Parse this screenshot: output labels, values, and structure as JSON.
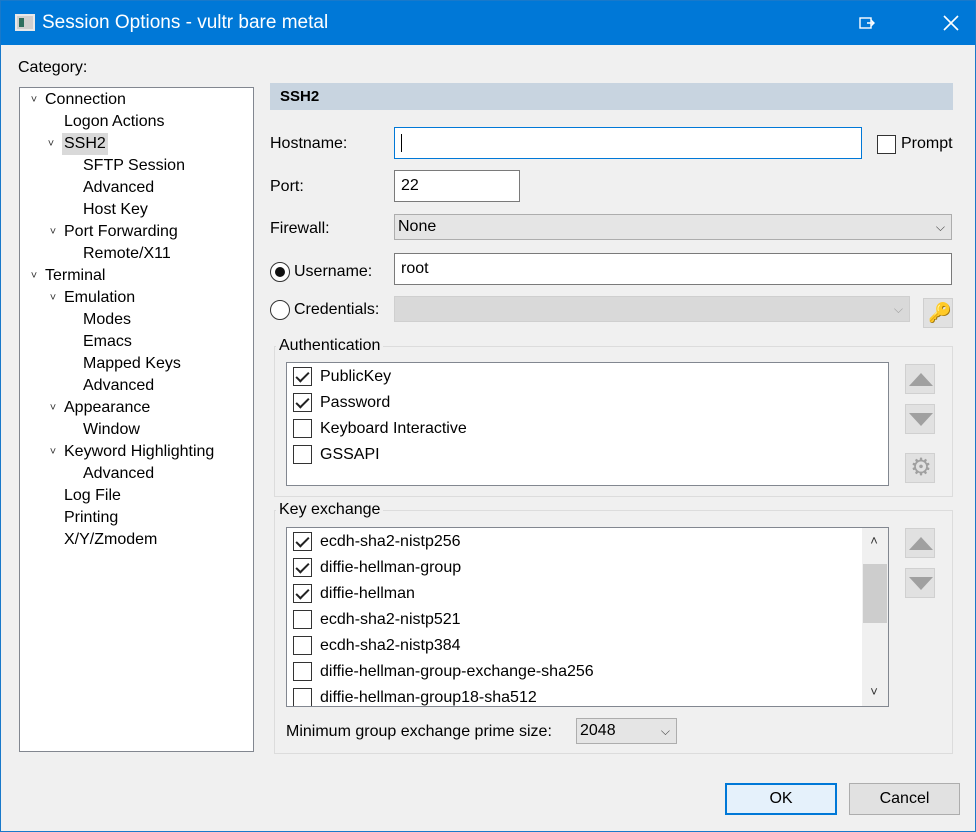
{
  "window": {
    "title": "Session Options - vultr bare metal",
    "restore_icon": "restore-icon",
    "close_icon": "close-icon"
  },
  "category_label": "Category:",
  "tree": [
    {
      "label": "Connection",
      "level": 0,
      "expanded": true
    },
    {
      "label": "Logon Actions",
      "level": 1
    },
    {
      "label": "SSH2",
      "level": 1,
      "expanded": true,
      "selected": true
    },
    {
      "label": "SFTP Session",
      "level": 2
    },
    {
      "label": "Advanced",
      "level": 2
    },
    {
      "label": "Host Key",
      "level": 2
    },
    {
      "label": "Port Forwarding",
      "level": 1,
      "expanded": true
    },
    {
      "label": "Remote/X11",
      "level": 2
    },
    {
      "label": "Terminal",
      "level": 0,
      "expanded": true
    },
    {
      "label": "Emulation",
      "level": 1,
      "expanded": true
    },
    {
      "label": "Modes",
      "level": 2
    },
    {
      "label": "Emacs",
      "level": 2
    },
    {
      "label": "Mapped Keys",
      "level": 2
    },
    {
      "label": "Advanced",
      "level": 2
    },
    {
      "label": "Appearance",
      "level": 1,
      "expanded": true
    },
    {
      "label": "Window",
      "level": 2
    },
    {
      "label": "Keyword Highlighting",
      "level": 1,
      "expanded": true
    },
    {
      "label": "Advanced",
      "level": 2
    },
    {
      "label": "Log File",
      "level": 1
    },
    {
      "label": "Printing",
      "level": 1
    },
    {
      "label": "X/Y/Zmodem",
      "level": 1
    }
  ],
  "section": {
    "title": "SSH2"
  },
  "form": {
    "hostname_label": "Hostname:",
    "hostname_value": "",
    "prompt_label": "Prompt",
    "port_label": "Port:",
    "port_value": "22",
    "firewall_label": "Firewall:",
    "firewall_value": "None",
    "username_label": "Username:",
    "username_value": "root",
    "credentials_label": "Credentials:",
    "credentials_value": ""
  },
  "authentication": {
    "title": "Authentication",
    "items": [
      {
        "label": "PublicKey",
        "checked": true
      },
      {
        "label": "Password",
        "checked": true
      },
      {
        "label": "Keyboard Interactive",
        "checked": false
      },
      {
        "label": "GSSAPI",
        "checked": false
      }
    ]
  },
  "key_exchange": {
    "title": "Key exchange",
    "items": [
      {
        "label": "ecdh-sha2-nistp256",
        "checked": true
      },
      {
        "label": "diffie-hellman-group",
        "checked": true
      },
      {
        "label": "diffie-hellman",
        "checked": true
      },
      {
        "label": "ecdh-sha2-nistp521",
        "checked": false
      },
      {
        "label": "ecdh-sha2-nistp384",
        "checked": false
      },
      {
        "label": "diffie-hellman-group-exchange-sha256",
        "checked": false
      },
      {
        "label": "diffie-hellman-group18-sha512",
        "checked": false
      }
    ],
    "min_prime_label": "Minimum group exchange prime size:",
    "min_prime_value": "2048"
  },
  "buttons": {
    "ok": "OK",
    "cancel": "Cancel"
  },
  "colors": {
    "accent": "#0078d7",
    "header_bar": "#c8d4e0"
  }
}
